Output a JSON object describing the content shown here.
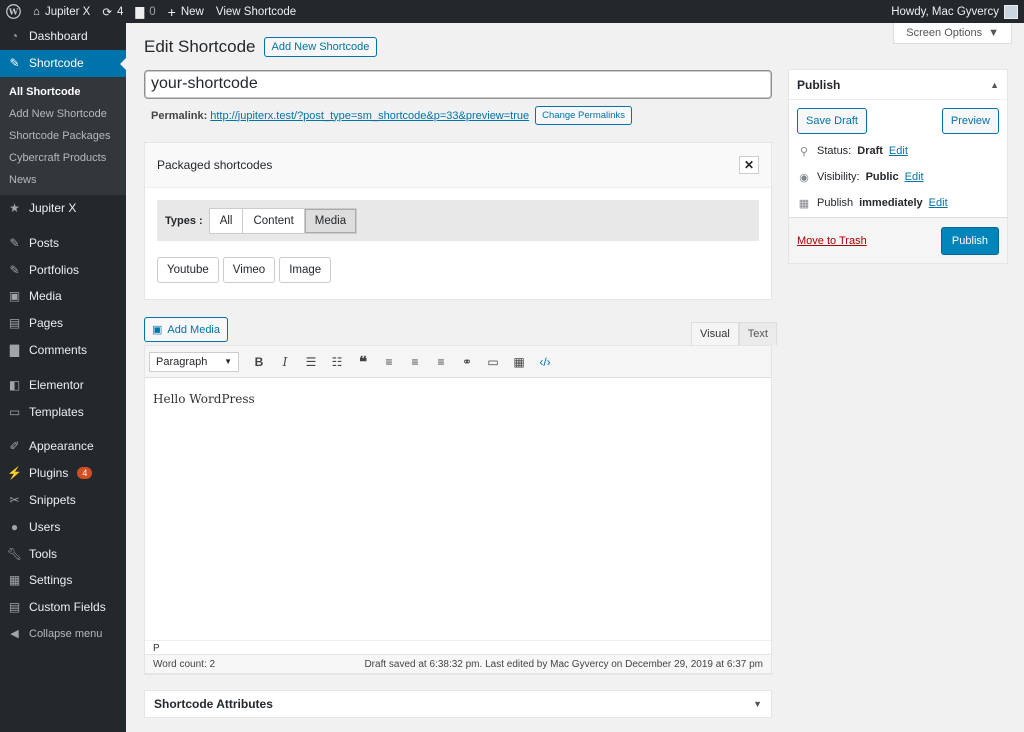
{
  "adminbar": {
    "site_name": "Jupiter X",
    "updates_count": "4",
    "comments_count": "0",
    "new_label": "New",
    "view_label": "View Shortcode",
    "howdy": "Howdy, Mac Gyvercy"
  },
  "sidebar": {
    "items": [
      {
        "label": "Dashboard",
        "icon": "dashboard-icon"
      },
      {
        "label": "Shortcode",
        "icon": "pin-icon"
      },
      {
        "label": "Jupiter X",
        "icon": "star-icon"
      },
      {
        "label": "Posts",
        "icon": "pin-icon"
      },
      {
        "label": "Portfolios",
        "icon": "pin-icon"
      },
      {
        "label": "Media",
        "icon": "media-icon"
      },
      {
        "label": "Pages",
        "icon": "pages-icon"
      },
      {
        "label": "Comments",
        "icon": "comments-icon"
      },
      {
        "label": "Elementor",
        "icon": "elementor-icon"
      },
      {
        "label": "Templates",
        "icon": "folder-icon"
      },
      {
        "label": "Appearance",
        "icon": "brush-icon"
      },
      {
        "label": "Plugins",
        "icon": "plugin-icon"
      },
      {
        "label": "Snippets",
        "icon": "scissors-icon"
      },
      {
        "label": "Users",
        "icon": "user-icon"
      },
      {
        "label": "Tools",
        "icon": "wrench-icon"
      },
      {
        "label": "Settings",
        "icon": "settings-icon"
      },
      {
        "label": "Custom Fields",
        "icon": "table-icon"
      },
      {
        "label": "Collapse menu",
        "icon": "collapse-icon"
      }
    ],
    "plugins_badge": "4",
    "submenu": [
      "All Shortcode",
      "Add New Shortcode",
      "Shortcode Packages",
      "Cybercraft Products",
      "News"
    ]
  },
  "main": {
    "screen_options": "Screen Options",
    "heading": "Edit Shortcode",
    "add_new": "Add New Shortcode",
    "title_value": "your-shortcode",
    "permalink_label": "Permalink:",
    "permalink_url": "http://jupiterx.test/?post_type=sm_shortcode&p=33&preview=true",
    "change_permalinks": "Change Permalinks"
  },
  "packaged": {
    "title": "Packaged shortcodes",
    "types_label": "Types :",
    "types": [
      "All",
      "Content",
      "Media"
    ],
    "selected_type": "Media",
    "shortcodes": [
      "Youtube",
      "Vimeo",
      "Image"
    ]
  },
  "editor": {
    "add_media": "Add Media",
    "tab_visual": "Visual",
    "tab_text": "Text",
    "format": "Paragraph",
    "content": "Hello WordPress",
    "path": "P",
    "word_count": "Word count: 2",
    "draft_status": "Draft saved at 6:38:32 pm. Last edited by Mac Gyvercy on December 29, 2019 at 6:37 pm"
  },
  "attributes": {
    "title": "Shortcode Attributes"
  },
  "publish": {
    "title": "Publish",
    "save_draft": "Save Draft",
    "preview": "Preview",
    "status_label": "Status:",
    "status_value": "Draft",
    "visibility_label": "Visibility:",
    "visibility_value": "Public",
    "publish_label": "Publish",
    "publish_value": "immediately",
    "edit": "Edit",
    "trash": "Move to Trash",
    "publish_button": "Publish"
  }
}
